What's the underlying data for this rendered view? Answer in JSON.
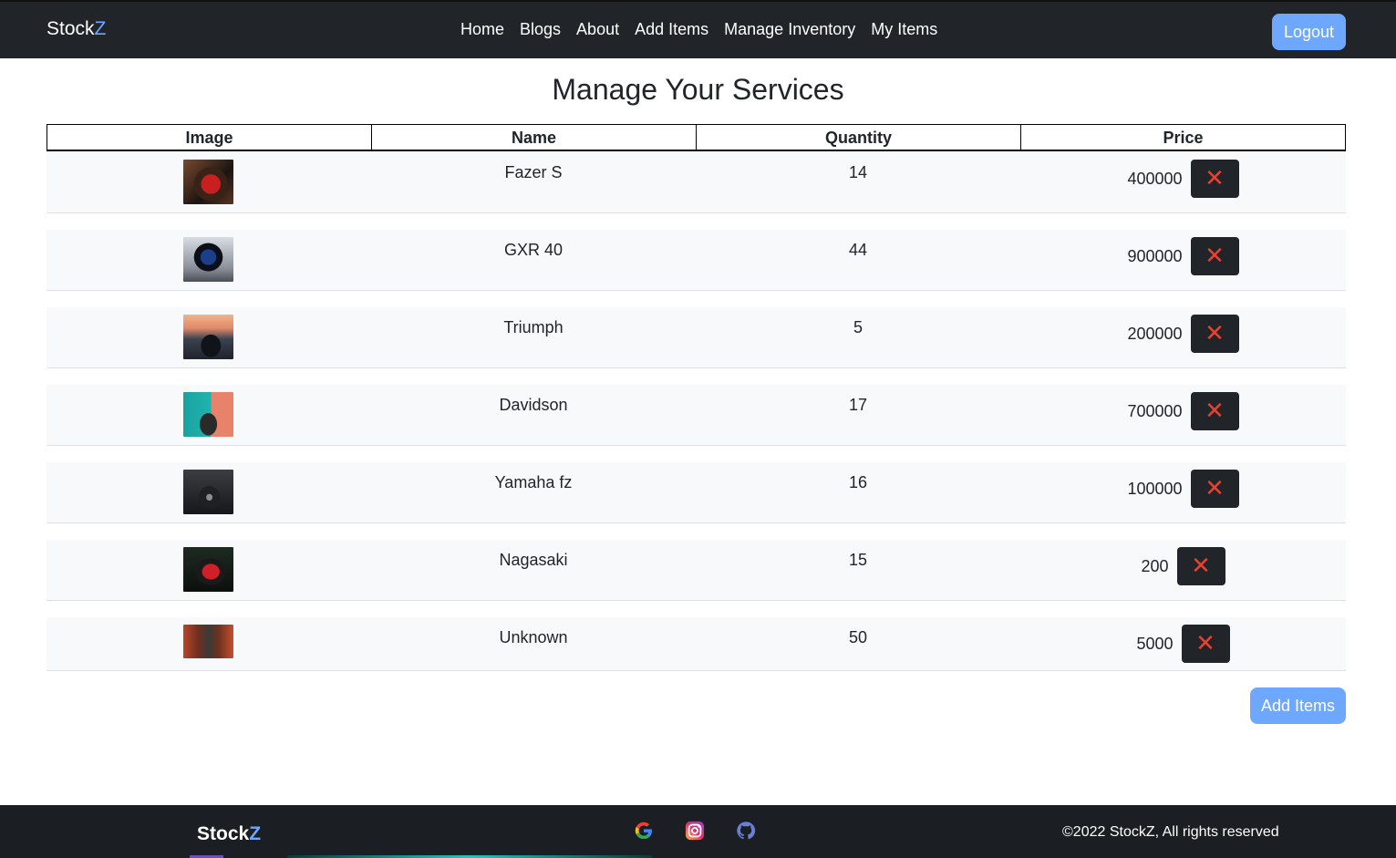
{
  "brand": {
    "main": "Stock",
    "accent": "Z"
  },
  "nav": {
    "links": [
      "Home",
      "Blogs",
      "About",
      "Add Items",
      "Manage Inventory",
      "My Items"
    ],
    "logout_label": "Logout"
  },
  "page": {
    "title": "Manage Your Services"
  },
  "table": {
    "headers": [
      "Image",
      "Name",
      "Quantity",
      "Price"
    ],
    "rows": [
      {
        "name": "Fazer S",
        "quantity": "14",
        "price": "400000",
        "delete_label": "✕"
      },
      {
        "name": "GXR 40",
        "quantity": "44",
        "price": "900000",
        "delete_label": "✕"
      },
      {
        "name": "Triumph",
        "quantity": "5",
        "price": "200000",
        "delete_label": "✕"
      },
      {
        "name": "Davidson",
        "quantity": "17",
        "price": "700000",
        "delete_label": "✕"
      },
      {
        "name": "Yamaha fz",
        "quantity": "16",
        "price": "100000",
        "delete_label": "✕"
      },
      {
        "name": "Nagasaki",
        "quantity": "15",
        "price": "200",
        "delete_label": "✕"
      },
      {
        "name": "Unknown",
        "quantity": "50",
        "price": "5000",
        "delete_label": "✕"
      }
    ]
  },
  "actions": {
    "add_items_label": "Add Items"
  },
  "footer": {
    "brand_main": "Stock",
    "brand_accent": "Z",
    "icons": [
      "google-icon",
      "instagram-icon",
      "github-icon"
    ],
    "copyright": "©2022 StockZ, All rights reserved"
  },
  "colors": {
    "navbar_bg": "#212529",
    "accent": "#6ea8fe",
    "delete_icon": "#e8412f",
    "row_bg": "#f8f9fa"
  }
}
